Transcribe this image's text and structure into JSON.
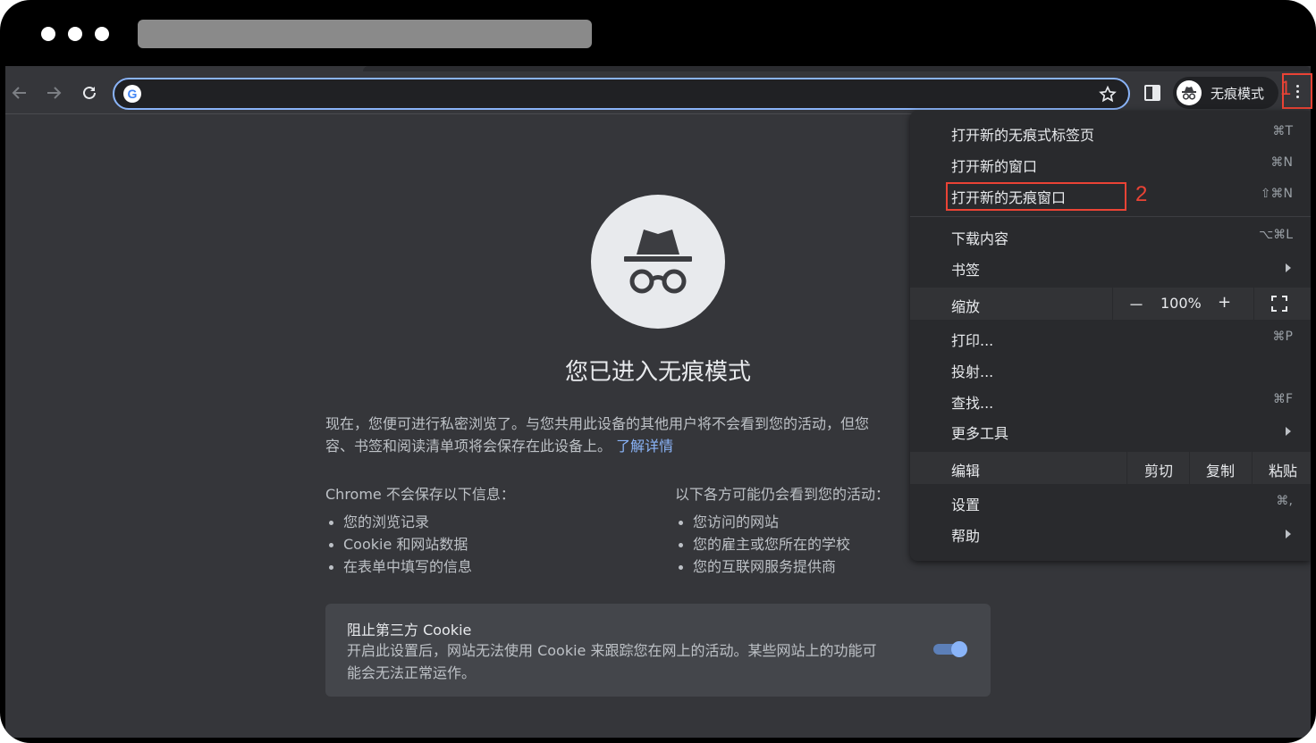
{
  "browser": {
    "mode_label": "无痕模式",
    "annotation_menu_button": "1"
  },
  "page": {
    "title": "您已进入无痕模式",
    "intro_line1": "现在，您便可进行私密浏览了。与您共用此设备的其他用户将不会看到您的活动，但您",
    "intro_line2": "容、书签和阅读清单项将会保存在此设备上。",
    "learn_more": "了解详情",
    "not_saved_heading": "Chrome 不会保存以下信息：",
    "not_saved_items": [
      "您的浏览记录",
      "Cookie 和网站数据",
      "在表单中填写的信息"
    ],
    "visible_heading": "以下各方可能仍会看到您的活动：",
    "visible_items": [
      "您访问的网站",
      "您的雇主或您所在的学校",
      "您的互联网服务提供商"
    ],
    "cookie_card": {
      "title": "阻止第三方 Cookie",
      "desc_line1": "开启此设置后，网站无法使用 Cookie 来跟踪您在网上的活动。某些网站上的功能可",
      "desc_line2": "能会无法正常运作。",
      "toggle_on": true
    }
  },
  "menu": {
    "items": [
      {
        "label": "打开新的无痕式标签页",
        "shortcut": "⌘T"
      },
      {
        "label": "打开新的窗口",
        "shortcut": "⌘N"
      },
      {
        "label": "打开新的无痕窗口",
        "shortcut": "⇧⌘N"
      },
      {
        "label": "下载内容",
        "shortcut": "⌥⌘L"
      },
      {
        "label": "书签",
        "shortcut": ""
      },
      {
        "label": "打印...",
        "shortcut": "⌘P"
      },
      {
        "label": "投射...",
        "shortcut": ""
      },
      {
        "label": "查找...",
        "shortcut": "⌘F"
      },
      {
        "label": "更多工具",
        "shortcut": ""
      },
      {
        "label": "设置",
        "shortcut": "⌘,"
      },
      {
        "label": "帮助",
        "shortcut": ""
      }
    ],
    "zoom": {
      "label": "缩放",
      "minus": "－",
      "value": "100%",
      "plus": "+"
    },
    "edit": {
      "label": "编辑",
      "cut": "剪切",
      "copy": "复制",
      "paste": "粘贴"
    },
    "annotation_highlight": "2"
  },
  "colors": {
    "annotation_red": "#ea4335",
    "link_blue": "#8ab4f8",
    "page_bg": "#35363a"
  }
}
